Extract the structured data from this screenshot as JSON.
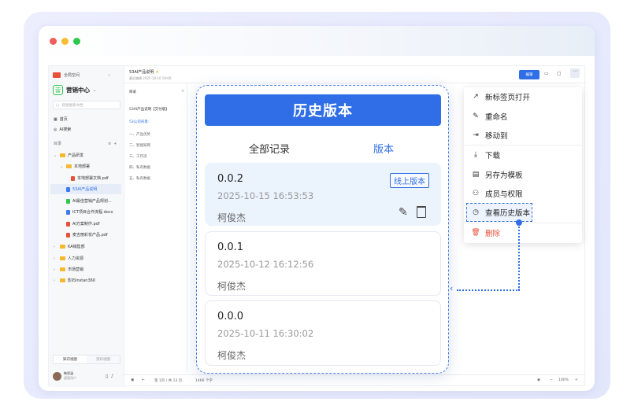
{
  "sidebar": {
    "brand_mini": "全局空间",
    "space_name": "营销中心",
    "search_placeholder": "快速搜索文档",
    "nav": [
      "首页",
      "AI搜索"
    ],
    "dir_label": "目录",
    "tree": [
      {
        "label": "产品研发",
        "type": "folder",
        "level": 0
      },
      {
        "label": "本地部署",
        "type": "folder",
        "level": 1
      },
      {
        "label": "本地部署文档.pdf",
        "type": "pdf",
        "level": 2
      },
      {
        "label": "53AI产品说明",
        "type": "doc",
        "level": 1
      },
      {
        "label": "AI最佳营销产品规划...",
        "type": "doc",
        "level": 1
      },
      {
        "label": "ICT项目合作流程.docx",
        "type": "doc",
        "level": 1
      },
      {
        "label": "AI方案制作.pdf",
        "type": "pdf",
        "level": 1
      },
      {
        "label": "麦吉丽彩妆产品.pdf",
        "type": "pdf",
        "level": 1
      },
      {
        "label": "KA销售部",
        "type": "folder",
        "level": 0
      },
      {
        "label": "人力资源",
        "type": "folder",
        "level": 0
      },
      {
        "label": "市场营销",
        "type": "folder",
        "level": 0
      },
      {
        "label": "影石Instan360",
        "type": "folder",
        "level": 0
      }
    ],
    "bottom_tabs": [
      "知识视图",
      "资料视图"
    ],
    "user_name": "韩思涵",
    "user_sub": "超管用户"
  },
  "doc_header": {
    "title": "53AI产品说明",
    "subtitle": "最近编辑 2025-10-10 19:00",
    "edit_button": "编辑"
  },
  "outline": {
    "label": "目录",
    "doc_title": "53AI产品说明【交付版】",
    "section": "53公司背景:",
    "items": [
      "一、产品优势",
      "二、智能知网",
      "三、工作流",
      "四、私有数据",
      "五、私有数据"
    ]
  },
  "bottombar": {
    "page_info": "第 1页 / 共 13 页",
    "word_count": "1466 个字",
    "zoom": "100%"
  },
  "history_panel": {
    "title": "历史版本",
    "tabs": [
      "全部记录",
      "版本"
    ],
    "active_tab": "版本",
    "versions": [
      {
        "version": "0.0.2",
        "date": "2025-10-15 16:53:53",
        "author": "柯俊杰",
        "badge": "线上版本"
      },
      {
        "version": "0.0.1",
        "date": "2025-10-12 16:12:56",
        "author": "柯俊杰"
      },
      {
        "version": "0.0.0",
        "date": "2025-10-11 16:30:02",
        "author": "柯俊杰"
      }
    ]
  },
  "context_menu": {
    "items": [
      {
        "label": "新标签页打开",
        "icon": "open-new-tab-icon",
        "glyph": "↗"
      },
      {
        "label": "重命名",
        "icon": "pencil-icon",
        "glyph": "✎"
      },
      {
        "label": "移动到",
        "icon": "move-folder-icon",
        "glyph": "⇥"
      },
      {
        "label": "下载",
        "icon": "download-icon",
        "glyph": "⤓"
      },
      {
        "label": "另存为模板",
        "icon": "template-icon",
        "glyph": "▤"
      },
      {
        "label": "成员与权限",
        "icon": "members-icon",
        "glyph": "⚇"
      },
      {
        "label": "查看历史版本",
        "icon": "history-clock-icon",
        "glyph": "◷"
      },
      {
        "label": "删除",
        "icon": "trash-icon",
        "glyph": "🗑"
      }
    ],
    "highlight_color": "#2f6ee6",
    "danger_color": "#e8503a"
  },
  "colors": {
    "accent": "#2f6ee6",
    "traffic_red": "#f35f5b",
    "traffic_yellow": "#f8be32",
    "traffic_green": "#2ec84c"
  }
}
